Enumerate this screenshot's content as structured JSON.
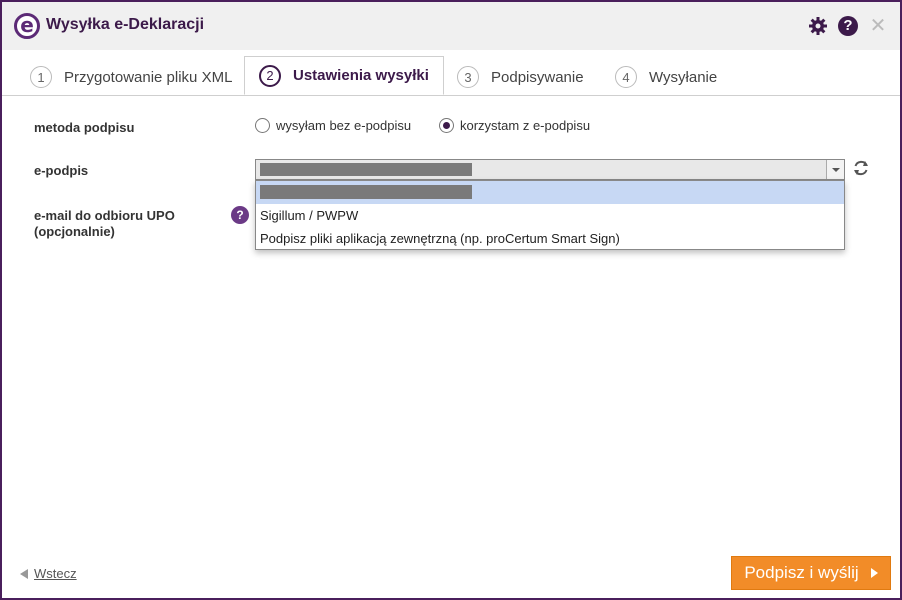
{
  "window": {
    "title": "Wysyłka e-Deklaracji",
    "logo_letter": "e",
    "help_glyph": "?",
    "close_glyph": "✕",
    "accent": "#3c1a4a"
  },
  "tabs": [
    {
      "num": "1",
      "label": "Przygotowanie pliku XML",
      "active": false
    },
    {
      "num": "2",
      "label": "Ustawienia wysyłki",
      "active": true
    },
    {
      "num": "3",
      "label": "Podpisywanie",
      "active": false
    },
    {
      "num": "4",
      "label": "Wysyłanie",
      "active": false
    }
  ],
  "form": {
    "method_label": "metoda podpisu",
    "radio_no_signature": "wysyłam bez e-podpisu",
    "radio_with_signature": "korzystam z e-podpisu",
    "radio_selected": "korzystam z e-podpisu",
    "esign_label": "e-podpis",
    "email_label_line1": "e-mail do odbioru UPO",
    "email_label_line2": "(opcjonalnie)",
    "help_glyph": "?"
  },
  "dropdown": {
    "options": [
      "Sigillum / PWPW",
      "Podpisz pliki aplikacją zewnętrzną (np. proCertum Smart Sign)"
    ]
  },
  "footer": {
    "back_label": "Wstecz",
    "submit_label": "Podpisz i wyślij",
    "submit_color": "#f28c28"
  }
}
